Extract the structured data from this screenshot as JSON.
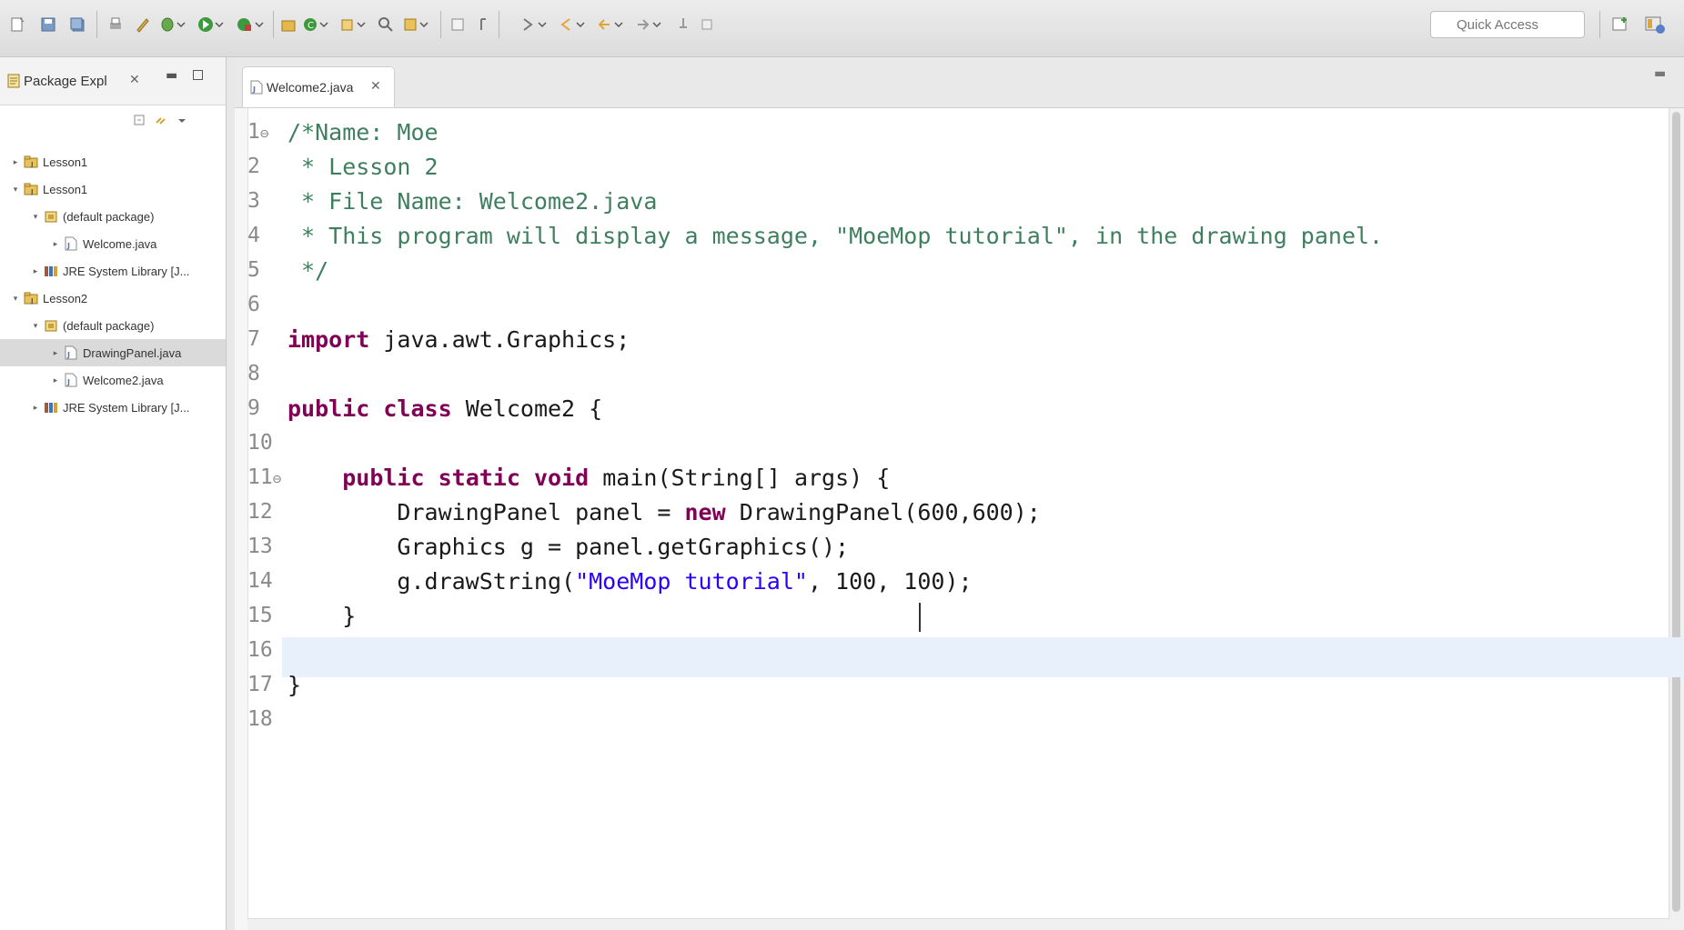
{
  "toolbar": {
    "quick_access_placeholder": "Quick Access"
  },
  "package_explorer": {
    "title": "Package Expl",
    "close_glyph": "✕",
    "tree": [
      {
        "label": "Lesson1",
        "type": "project",
        "depth": 0,
        "expanded": false
      },
      {
        "label": "Lesson1",
        "type": "project",
        "depth": 0,
        "expanded": true
      },
      {
        "label": "(default package)",
        "type": "package",
        "depth": 1,
        "expanded": true
      },
      {
        "label": "Welcome.java",
        "type": "java-file",
        "depth": 2,
        "expanded": false
      },
      {
        "label": "JRE System Library [J...",
        "type": "library",
        "depth": 1,
        "expanded": false
      },
      {
        "label": "Lesson2",
        "type": "project",
        "depth": 0,
        "expanded": true
      },
      {
        "label": "(default package)",
        "type": "package",
        "depth": 1,
        "expanded": true
      },
      {
        "label": "DrawingPanel.java",
        "type": "java-file",
        "depth": 2,
        "expanded": false,
        "selected": true
      },
      {
        "label": "Welcome2.java",
        "type": "java-file",
        "depth": 2,
        "expanded": false
      },
      {
        "label": "JRE System Library [J...",
        "type": "library",
        "depth": 1,
        "expanded": false
      }
    ]
  },
  "editor": {
    "tab_label": "Welcome2.java",
    "tab_close_glyph": "✕",
    "lines": [
      {
        "n": "1",
        "fold": "⊖",
        "segments": [
          {
            "t": "/*Name: Moe",
            "c": "cm"
          }
        ]
      },
      {
        "n": "2",
        "segments": [
          {
            "t": " * Lesson 2",
            "c": "cm"
          }
        ]
      },
      {
        "n": "3",
        "segments": [
          {
            "t": " * File Name: Welcome2.java",
            "c": "cm"
          }
        ]
      },
      {
        "n": "4",
        "segments": [
          {
            "t": " * This program will display a message, \"MoeMop tutorial\", in the drawing panel.",
            "c": "cm"
          }
        ]
      },
      {
        "n": "5",
        "segments": [
          {
            "t": " */",
            "c": "cm"
          }
        ]
      },
      {
        "n": "6",
        "segments": []
      },
      {
        "n": "7",
        "segments": [
          {
            "t": "import",
            "c": "kw"
          },
          {
            "t": " java.awt.Graphics;",
            "c": ""
          }
        ]
      },
      {
        "n": "8",
        "segments": []
      },
      {
        "n": "9",
        "segments": [
          {
            "t": "public",
            "c": "kw"
          },
          {
            "t": " ",
            "c": ""
          },
          {
            "t": "class",
            "c": "kw"
          },
          {
            "t": " Welcome2 {",
            "c": ""
          }
        ]
      },
      {
        "n": "10",
        "segments": []
      },
      {
        "n": "11",
        "fold": "⊖",
        "segments": [
          {
            "t": "    ",
            "c": ""
          },
          {
            "t": "public",
            "c": "kw"
          },
          {
            "t": " ",
            "c": ""
          },
          {
            "t": "static",
            "c": "kw"
          },
          {
            "t": " ",
            "c": ""
          },
          {
            "t": "void",
            "c": "kw"
          },
          {
            "t": " main(String[] args) {",
            "c": ""
          }
        ]
      },
      {
        "n": "12",
        "segments": [
          {
            "t": "        DrawingPanel panel = ",
            "c": ""
          },
          {
            "t": "new",
            "c": "kw"
          },
          {
            "t": " DrawingPanel(600,600);",
            "c": ""
          }
        ]
      },
      {
        "n": "13",
        "segments": [
          {
            "t": "        Graphics g = panel.getGraphics();",
            "c": ""
          }
        ]
      },
      {
        "n": "14",
        "segments": [
          {
            "t": "        g.drawString(",
            "c": ""
          },
          {
            "t": "\"MoeMop tutorial\"",
            "c": "str"
          },
          {
            "t": ", 100, 100);",
            "c": ""
          }
        ]
      },
      {
        "n": "15",
        "segments": [
          {
            "t": "    }",
            "c": ""
          }
        ]
      },
      {
        "n": "16",
        "segments": []
      },
      {
        "n": "17",
        "segments": [
          {
            "t": "}",
            "c": ""
          }
        ]
      },
      {
        "n": "18",
        "segments": []
      }
    ]
  },
  "colors": {
    "comment": "#3f7f5f",
    "keyword": "#7f0055",
    "string": "#2a00ff",
    "current_line": "#e8f0fb"
  }
}
